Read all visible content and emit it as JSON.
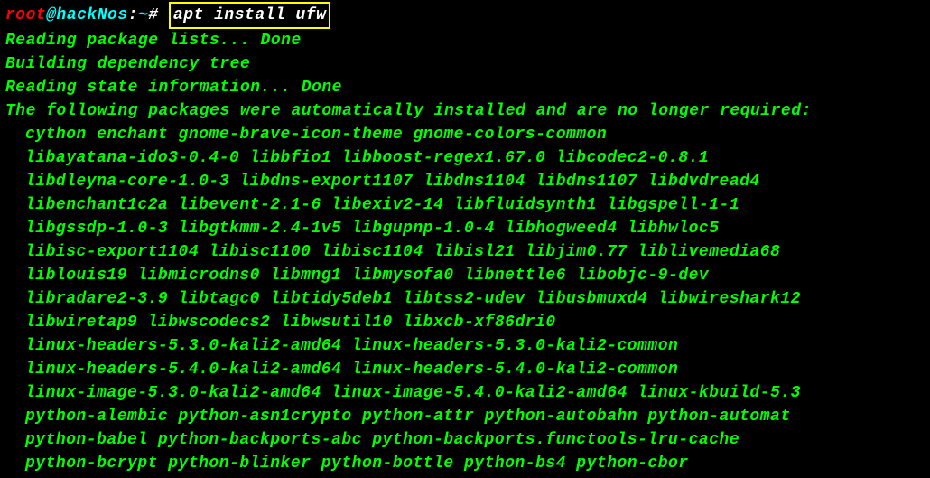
{
  "prompt": {
    "user": "root",
    "at": "@",
    "host": "hackNos",
    "colon": ":",
    "path": "~",
    "hash": "#",
    "command": "apt install ufw"
  },
  "lines": [
    "Reading package lists... Done",
    "Building dependency tree",
    "Reading state information... Done",
    "The following packages were automatically installed and are no longer required:"
  ],
  "packages": [
    "cython enchant gnome-brave-icon-theme gnome-colors-common",
    "libayatana-ido3-0.4-0 libbfio1 libboost-regex1.67.0 libcodec2-0.8.1",
    "libdleyna-core-1.0-3 libdns-export1107 libdns1104 libdns1107 libdvdread4",
    "libenchant1c2a libevent-2.1-6 libexiv2-14 libfluidsynth1 libgspell-1-1",
    "libgssdp-1.0-3 libgtkmm-2.4-1v5 libgupnp-1.0-4 libhogweed4 libhwloc5",
    "libisc-export1104 libisc1100 libisc1104 libisl21 libjim0.77 liblivemedia68",
    "liblouis19 libmicrodns0 libmng1 libmysofa0 libnettle6 libobjc-9-dev",
    "libradare2-3.9 libtagc0 libtidy5deb1 libtss2-udev libusbmuxd4 libwireshark12",
    "libwiretap9 libwscodecs2 libwsutil10 libxcb-xf86dri0",
    "linux-headers-5.3.0-kali2-amd64 linux-headers-5.3.0-kali2-common",
    "linux-headers-5.4.0-kali2-amd64 linux-headers-5.4.0-kali2-common",
    "linux-image-5.3.0-kali2-amd64 linux-image-5.4.0-kali2-amd64 linux-kbuild-5.3",
    "python-alembic python-asn1crypto python-attr python-autobahn python-automat",
    "python-babel python-backports-abc python-backports.functools-lru-cache",
    "python-bcrypt python-blinker python-bottle python-bs4 python-cbor"
  ]
}
